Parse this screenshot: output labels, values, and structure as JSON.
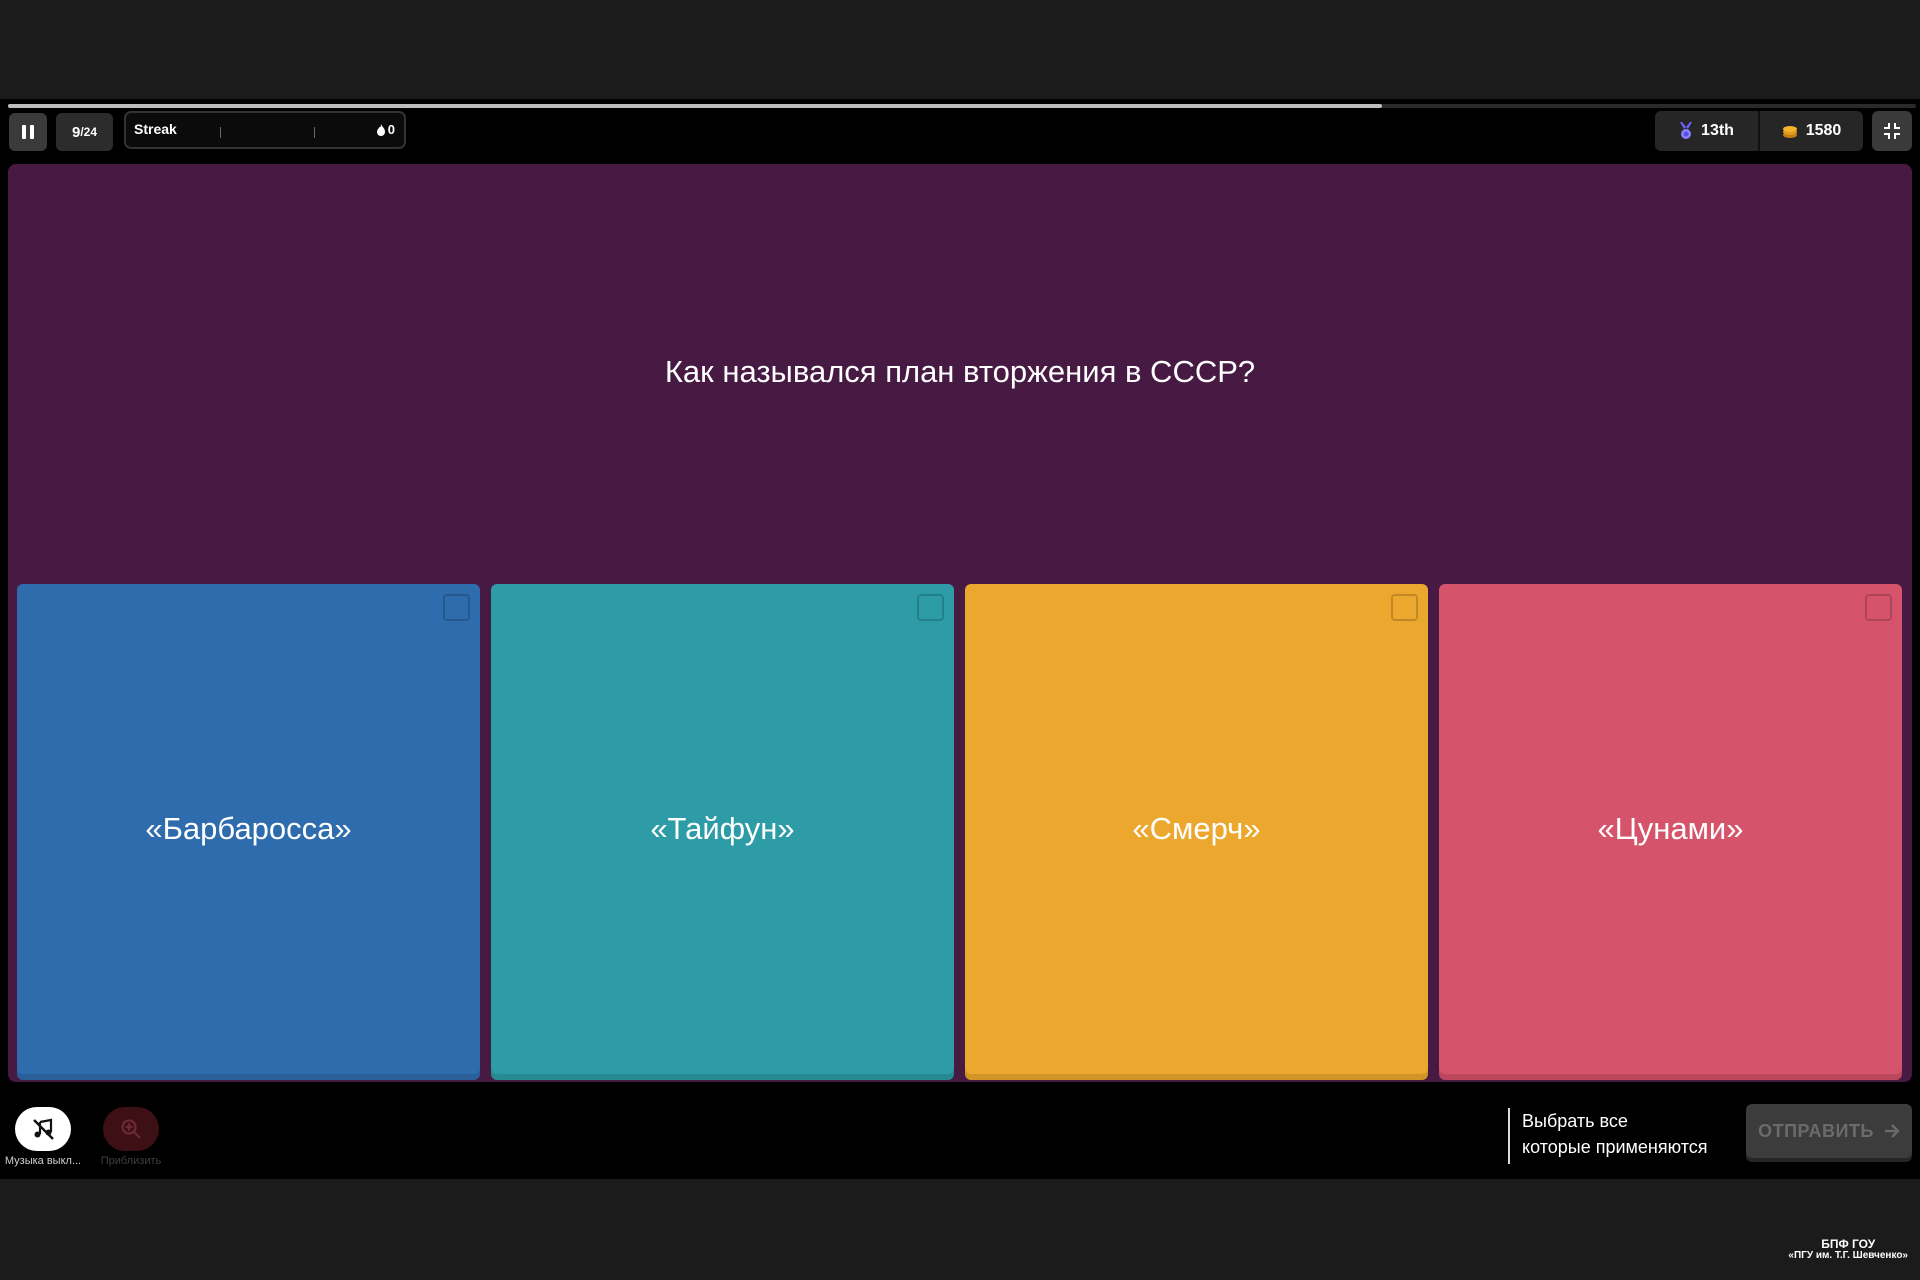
{
  "progress": {
    "fraction": 0.72
  },
  "top_bar": {
    "counter_current": "9",
    "counter_total": "24",
    "streak_label": "Streak",
    "streak_count": "0",
    "rank": "13th",
    "coins": "1580"
  },
  "question": {
    "text": "Как назывался план вторжения в СССР?"
  },
  "options": [
    {
      "label": "«Барбаросса»",
      "color": "#2f6cad",
      "shadow": "#2a5f98"
    },
    {
      "label": "«Тайфун»",
      "color": "#2d9ca6",
      "shadow": "#278992"
    },
    {
      "label": "«Смерч»",
      "color": "#eca82e",
      "shadow": "#d19426"
    },
    {
      "label": "«Цунами»",
      "color": "#d5546b",
      "shadow": "#bc475d"
    }
  ],
  "bottom_bar": {
    "music_label": "Музыка выкл...",
    "zoom_label": "Приблизить",
    "select_all_line1": "Выбрать все",
    "select_all_line2": "которые применяются",
    "submit_label": "ОТПРАВИТЬ"
  },
  "watermark": {
    "line1": "БПФ ГОУ",
    "line2": "«ПГУ им. Т.Г. Шевченко»"
  },
  "icons": {
    "pause": "pause-icon",
    "streak": "fire-icon",
    "rank": "medal-icon",
    "coins": "coins-icon",
    "fullscreen": "exit-fullscreen-icon",
    "music": "music-off-icon",
    "zoom": "zoom-in-icon",
    "submit_arrow": "arrow-right-icon"
  }
}
